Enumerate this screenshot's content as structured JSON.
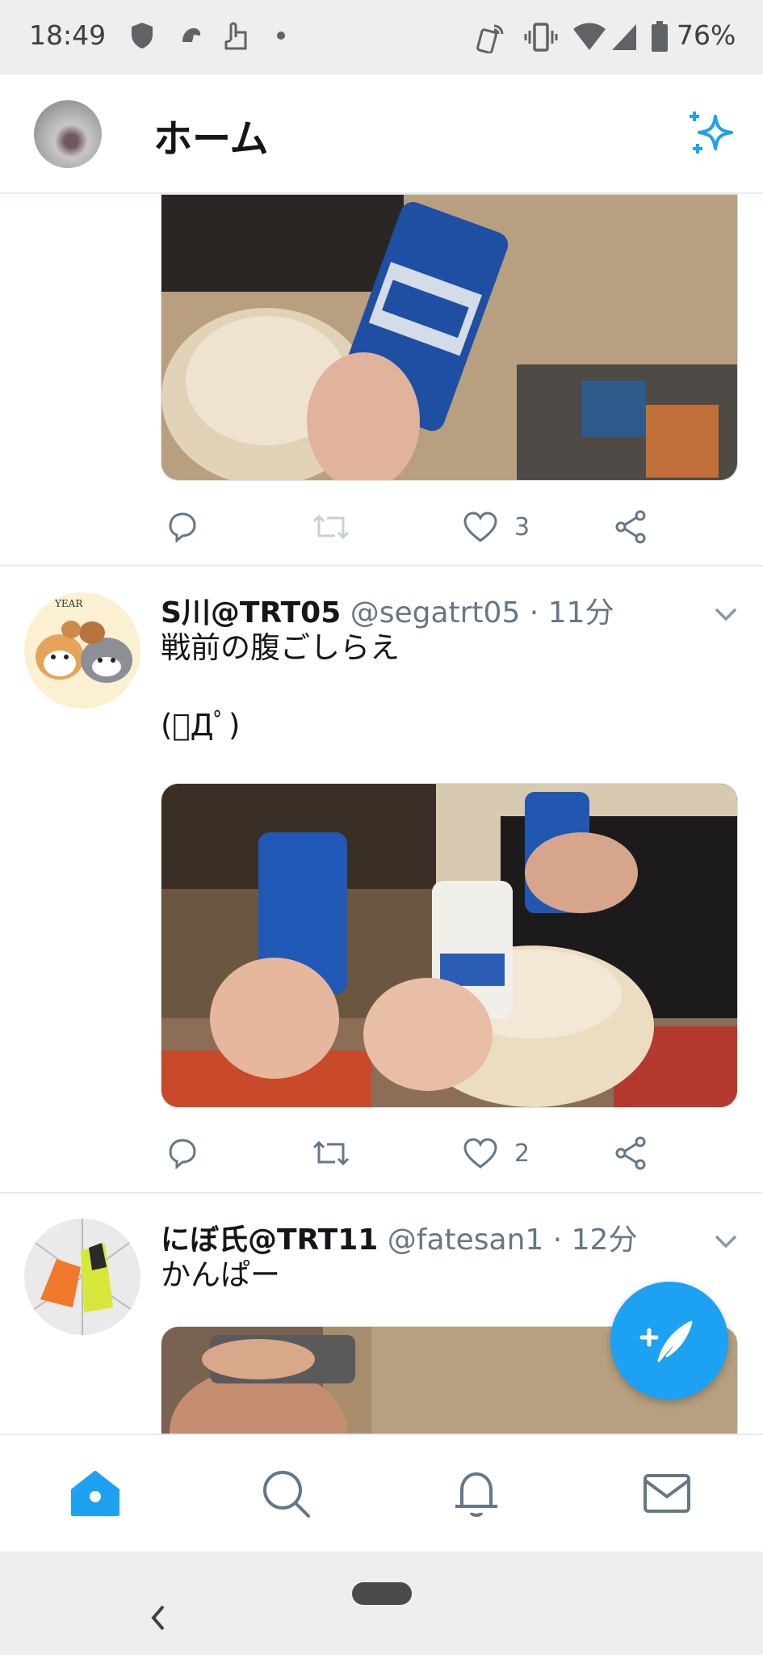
{
  "status_bar": {
    "time": "18:49",
    "battery": "76%",
    "icons": [
      "shield-icon",
      "app-notification-icon",
      "touch-icon",
      "dot-icon",
      "nfc-icon",
      "vibrate-icon",
      "wifi-icon",
      "signal-icon",
      "battery-icon"
    ]
  },
  "header": {
    "title": "ホーム",
    "left_icon": "profile-avatar",
    "right_icon": "sparkle-icon",
    "accent": "#1da1f2"
  },
  "feed": {
    "tweets": [
      {
        "partial": true,
        "image_description_icon": "beer-can-photo",
        "actions": {
          "reply": "",
          "retweet": "",
          "like": "3",
          "share": ""
        }
      },
      {
        "name": "S川@TRT05",
        "handle": "@segatrt05 · 11分",
        "text": "戦前の腹ごしらえ\n\n(ﾟДﾟ)",
        "actions": {
          "reply": "",
          "retweet": "",
          "like": "2",
          "share": ""
        }
      },
      {
        "name": "にぼ氏@TRT11",
        "handle": "@fatesan1 · 12分",
        "text": "かんぱー"
      }
    ]
  },
  "fab": {
    "icon": "compose-tweet-icon"
  },
  "bottom_nav": {
    "items": [
      "home-icon",
      "search-icon",
      "bell-icon",
      "mail-icon"
    ],
    "active": "home"
  },
  "system_nav": {
    "back_icon": "chevron-left-icon",
    "home_pill": "home-pill"
  }
}
